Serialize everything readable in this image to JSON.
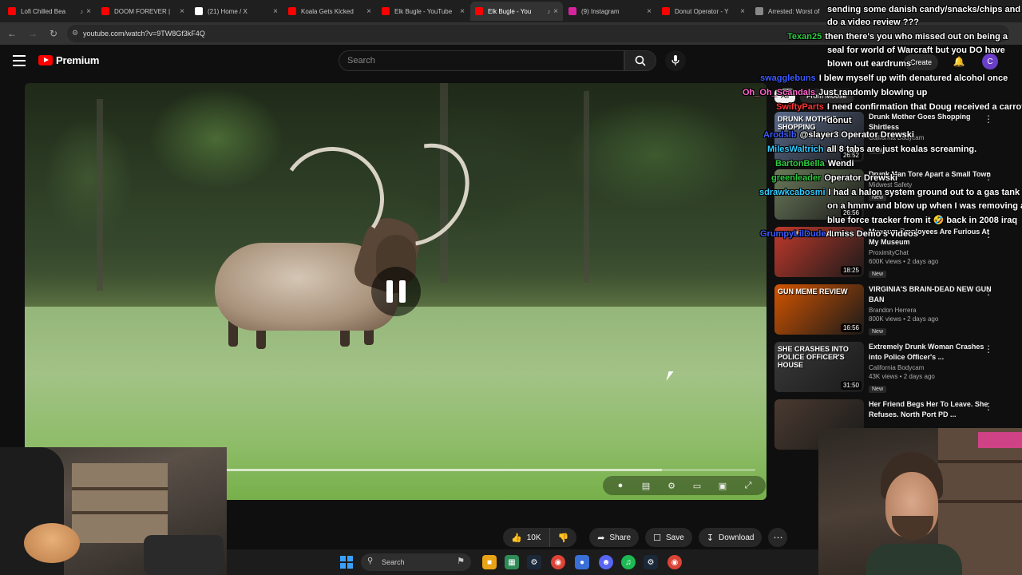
{
  "browser": {
    "tabs": [
      {
        "title": "Lofi Chilled Bea",
        "color": "#ff0000",
        "audio": true
      },
      {
        "title": "DOOM FOREVER | ",
        "color": "#ff0000",
        "audio": false
      },
      {
        "title": "(21) Home / X",
        "color": "#ffffff",
        "audio": false
      },
      {
        "title": "Koala Gets Kicked",
        "color": "#ff0000",
        "audio": false
      },
      {
        "title": "Elk Bugle - YouTube",
        "color": "#ff0000",
        "audio": false
      },
      {
        "title": "Elk Bugle - You",
        "color": "#ff0000",
        "audio": true,
        "active": true
      },
      {
        "title": "(9) Instagram",
        "color": "#d6249f",
        "audio": false
      },
      {
        "title": "Donut Operator - Y",
        "color": "#ff0000",
        "audio": false
      },
      {
        "title": "Arrested: Worst of",
        "color": "#888888",
        "audio": false
      }
    ],
    "url": "youtube.com/watch?v=9TW8Gf3kF4Q"
  },
  "youtube": {
    "brand": "Premium",
    "search_placeholder": "Search",
    "create_label": "Create",
    "avatar_letter": "C"
  },
  "player": {
    "progress_fraction": 0.0,
    "buffered_fraction": 0.87
  },
  "actions": {
    "likes": "10K",
    "share": "Share",
    "save": "Save",
    "download": "Download"
  },
  "sidebar": {
    "chips": [
      "All",
      "From Moose"
    ],
    "recommendations": [
      {
        "title": "Drunk Mother Goes Shopping Shirtless",
        "channel": "California Bodycam",
        "views": "",
        "badge": "New",
        "duration": "26:52",
        "thumb_text": "DRUNK MOTHER SHOPPING",
        "thumb_color": "#5a6a8a"
      },
      {
        "title": "Drunk Man Tore Apart a Small Town",
        "channel": "Midwest Safety",
        "views": "",
        "badge": "New",
        "duration": "26:56",
        "thumb_text": "",
        "thumb_color": "#6b7a5a"
      },
      {
        "title": "Museum Employees Are Furious At My Museum",
        "channel": "ProximityChat",
        "views": "600K views • 2 days ago",
        "badge": "New",
        "duration": "18:25",
        "thumb_text": "THIS IS ILLEGAL",
        "thumb_color": "#c0392b"
      },
      {
        "title": "VIRGINIA'S BRAIN-DEAD NEW GUN BAN",
        "channel": "Brandon Herrera",
        "views": "800K views • 2 days ago",
        "badge": "New",
        "duration": "16:56",
        "thumb_text": "GUN MEME REVIEW",
        "thumb_color": "#d35400"
      },
      {
        "title": "Extremely Drunk Woman Crashes into Police Officer's ...",
        "channel": "California Bodycam",
        "views": "43K views • 2 days ago",
        "badge": "New",
        "duration": "31:50",
        "thumb_text": "SHE CRASHES INTO POLICE OFFICER'S HOUSE",
        "thumb_color": "#3a3a3a"
      },
      {
        "title": "Her Friend Begs Her To Leave. She Refuses. North Port PD ...",
        "channel": "",
        "views": "",
        "badge": "",
        "duration": "",
        "thumb_text": "",
        "thumb_color": "#4a3a30"
      }
    ]
  },
  "chat": [
    {
      "user": "",
      "user_color": "#ffffff",
      "text": "sending some danish candy/snacks/chips and"
    },
    {
      "user": "",
      "user_color": "#ffffff",
      "text": "do a video review ???"
    },
    {
      "user": "Texan25",
      "user_color": "#2ecc40",
      "text": "then there's you who missed out on being a"
    },
    {
      "user": "",
      "user_color": "#ffffff",
      "text": "seal for world of Warcraft but you DO have"
    },
    {
      "user": "",
      "user_color": "#ffffff",
      "text": "blown out eardrums"
    },
    {
      "user": "swagglebuns",
      "user_color": "#3b5bff",
      "text": "I blew myself up with denatured alcohol once"
    },
    {
      "user": "Oh_Oh_Scandals",
      "user_color": "#ff66cc",
      "text": "Just randomly blowing up"
    },
    {
      "user": "SwiftyParts",
      "user_color": "#ff3333",
      "text": "I need confirmation that Doug received a carrot"
    },
    {
      "user": "",
      "user_color": "#ffffff",
      "text": "donut"
    },
    {
      "user": "Arodslb",
      "user_color": "#3b5bff",
      "text": "@slayer3 Operator Drewski"
    },
    {
      "user": "MilesWaltrich",
      "user_color": "#33ccff",
      "text": "all 8 tabs are just koalas screaming."
    },
    {
      "user": "BartonBella",
      "user_color": "#2ecc40",
      "text": "Wendi"
    },
    {
      "user": "greenleader",
      "user_color": "#2ecc40",
      "text": "Operator Drewski"
    },
    {
      "user": "sdrawkcabosmi",
      "user_color": "#33ccff",
      "text": "I had a halon system ground out to a gas tank"
    },
    {
      "user": "",
      "user_color": "#ffffff",
      "text": "on a hmmv and blow up when I was removing a"
    },
    {
      "user": "",
      "user_color": "#ffffff",
      "text": "blue force tracker from it 🤣 back in 2008 iraq"
    },
    {
      "user": "GrumpyLilDude",
      "user_color": "#3b5bff",
      "text": "I miss Demo's videos"
    }
  ],
  "taskbar": {
    "search": "Search"
  }
}
